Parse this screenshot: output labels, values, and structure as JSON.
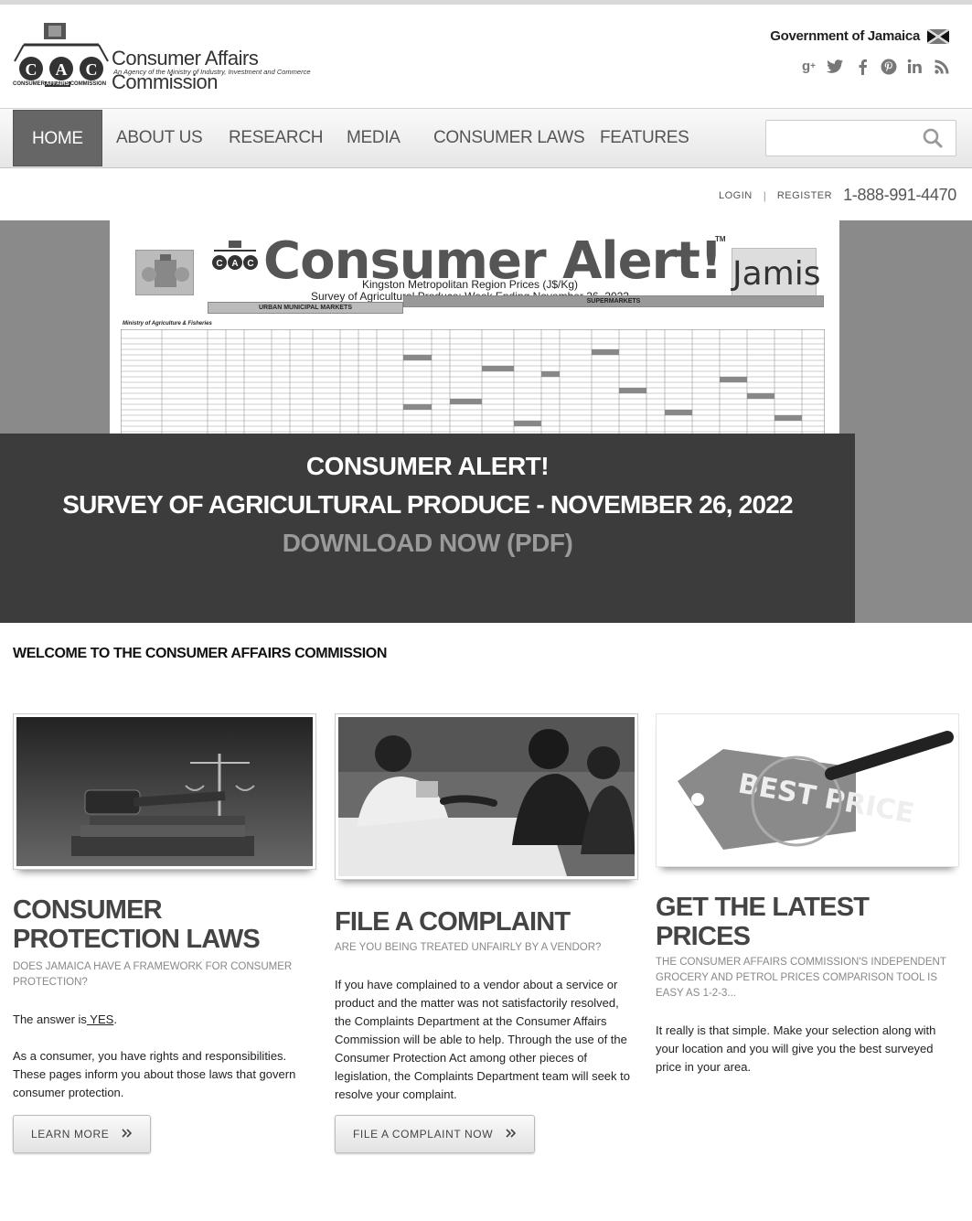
{
  "brand": {
    "name": "Consumer Affairs Commission",
    "tagline": "An Agency of the Ministry of Industry, Investment and Commerce",
    "logo_letters": "C A C",
    "logo_caption_pre": "CONSUMER",
    "logo_caption_mid": "AFFAIRS",
    "logo_caption_post": "COMMISSION"
  },
  "government": {
    "label": "Government of Jamaica"
  },
  "social": [
    "google-plus-icon",
    "twitter-icon",
    "facebook-icon",
    "pinterest-icon",
    "linkedin-icon",
    "rss-icon"
  ],
  "nav": {
    "items": [
      {
        "label": "HOME",
        "active": true
      },
      {
        "label": "ABOUT US"
      },
      {
        "label": "RESEARCH"
      },
      {
        "label": "MEDIA"
      },
      {
        "label": "CONSUMER LAWS"
      },
      {
        "label": "FEATURES"
      }
    ],
    "search": {
      "placeholder": ""
    }
  },
  "utility": {
    "login": "LOGIN",
    "separator": "|",
    "register": "REGISTER",
    "phone": "1-888-991-4470"
  },
  "banner": {
    "paper": {
      "title": "Consumer Alert!",
      "tm": "TM",
      "jamis": "Jamis",
      "subtitle1": "Kingston Metropolitan Region Prices (J$/Kg)",
      "subtitle2": "Survey of Agricultural Produce: Week Ending November 26, 2022",
      "urban_header": "URBAN MUNICIPAL MARKETS",
      "super_header": "SUPERMARKETS",
      "ministry": "Ministry of Agriculture & Fisheries"
    },
    "line1": "CONSUMER ALERT!",
    "line2": "SURVEY OF AGRICULTURAL PRODUCE - NOVEMBER 26, 2022",
    "line3": "DOWNLOAD NOW (PDF)"
  },
  "welcome": "WELCOME TO THE CONSUMER AFFAIRS COMMISSION",
  "columns": {
    "laws": {
      "title": "CONSUMER PROTECTION LAWS",
      "subtitle": "DOES JAMAICA HAVE A FRAMEWORK FOR CONSUMER PROTECTION?",
      "answer_prefix": "The answer is",
      "answer_link": " YES",
      "answer_suffix": ".",
      "body": "As a consumer, you have rights and responsibilities. These pages inform you about those laws that govern consumer protection.",
      "button": "LEARN MORE"
    },
    "complaint": {
      "title": "FILE A COMPLAINT",
      "subtitle": "ARE YOU BEING TREATED UNFAIRLY BY A VENDOR?",
      "body": "If you have complained to a vendor about a service or product and the matter was not satisfactorily resolved, the Complaints Department at the Consumer Affairs Commission will be able to help. Through the use of the Consumer Protection Act among other pieces of legislation, the Complaints Department team will seek to resolve your complaint.",
      "button": "FILE A COMPLAINT NOW"
    },
    "prices": {
      "title": "GET THE LATEST PRICES",
      "subtitle": "THE CONSUMER AFFAIRS COMMISSION'S INDEPENDENT GROCERY AND PETROL PRICES COMPARISON TOOL IS EASY AS 1-2-3...",
      "body": "It really is that simple. Make your selection along with your location and you will give you the best surveyed price in your area.",
      "image_text": "BEST PRICE"
    }
  },
  "button_icon": "double-chevron-right-icon"
}
